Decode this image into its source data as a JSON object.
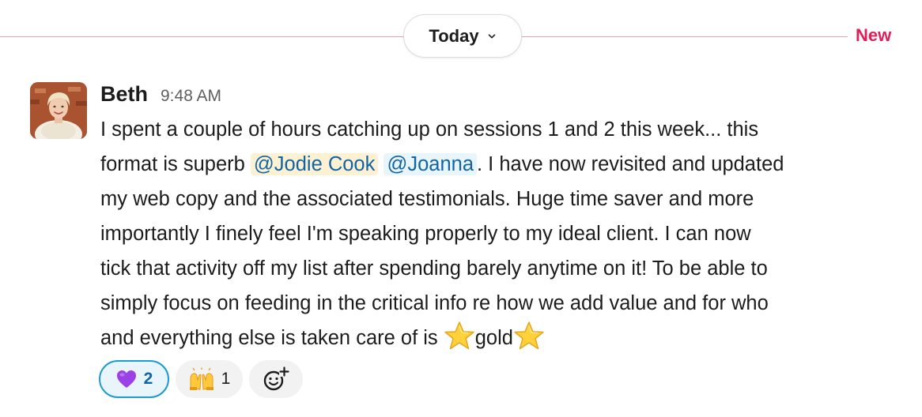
{
  "divider": {
    "date_label": "Today",
    "new_label": "New",
    "line_color": "#e0a6b7",
    "new_color": "#e01e5a"
  },
  "message": {
    "author": "Beth",
    "timestamp": "9:48 AM",
    "avatar_icon": "user-photo-avatar",
    "lines": {
      "l1": "I spent a couple of hours catching up on sessions 1 and 2 this week... this",
      "l2_pre": "format is superb ",
      "mention_1": "@Jodie Cook",
      "mention_2": "@Joanna",
      "l2_post": ".  I have now revisited and updated",
      "l3": "my web copy and the associated testimonials.  Huge time saver and more",
      "l4": "importantly I finely feel I'm speaking properly to my ideal client.  I can now",
      "l5": "tick that activity off my list after spending barely anytime on it! To be able to",
      "l6": "simply focus on feeding in the critical info re how we add value and for who",
      "l7_pre": "and everything else is taken care of is ",
      "l7_word": "gold"
    },
    "emoji": [
      "star-icon",
      "star-icon"
    ]
  },
  "reactions": {
    "heart": {
      "icon": "purple-heart-icon",
      "count": "2",
      "color": "#1d9bd1"
    },
    "hands": {
      "icon": "raised-hands-icon",
      "count": "1"
    },
    "add": {
      "icon": "add-reaction-icon"
    }
  }
}
